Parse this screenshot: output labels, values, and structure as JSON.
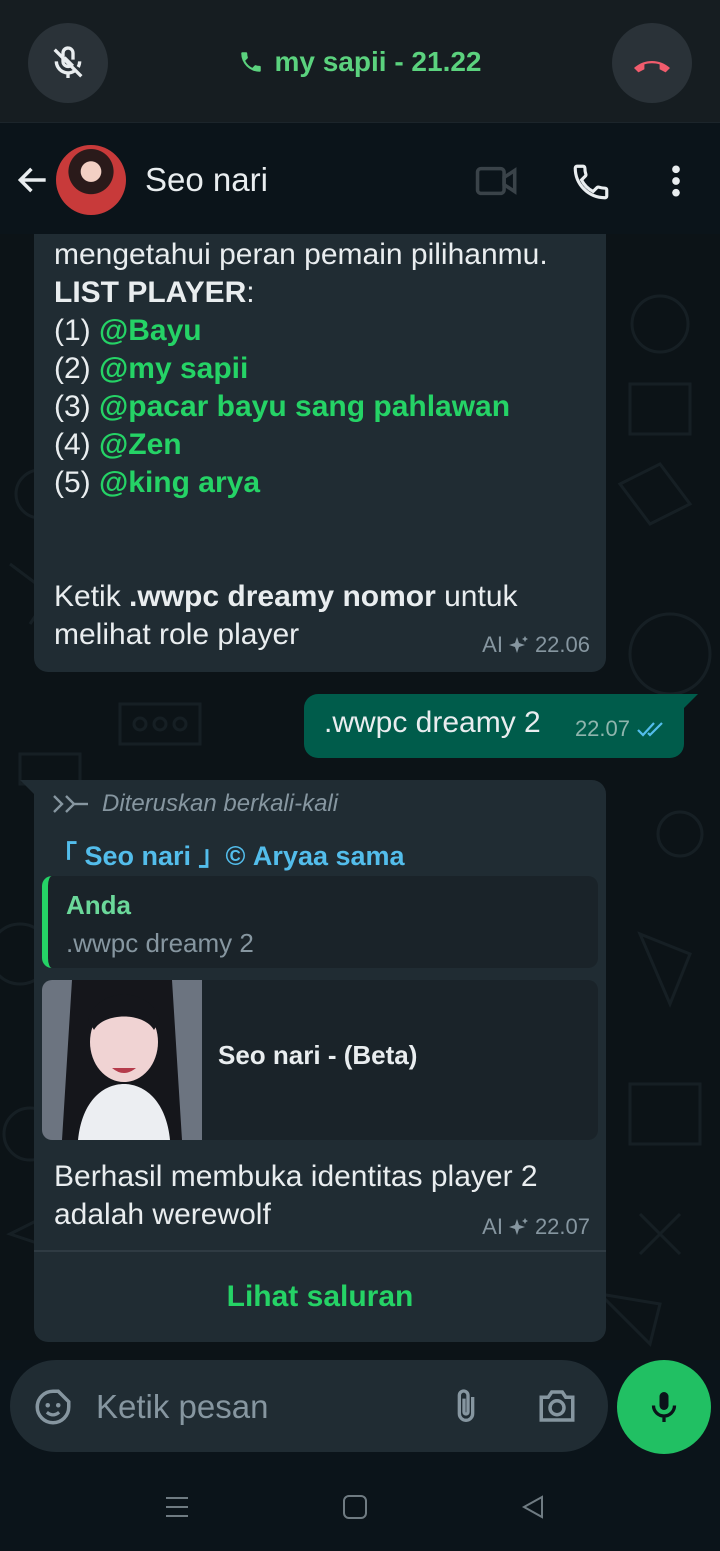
{
  "call": {
    "label": "my sapii - 21.22",
    "mute_icon": "mic-off-icon",
    "end_icon": "call-end-icon"
  },
  "header": {
    "contact_name": "Seo nari",
    "icons": [
      "back-arrow-icon",
      "video-call-icon",
      "phone-icon",
      "more-vert-icon"
    ]
  },
  "messages": {
    "m1": {
      "line_intro": "mengetahui peran pemain pilihanmu.",
      "list_title": "LIST PLAYER",
      "list_colon": ":",
      "players": [
        {
          "num": "(1)",
          "name": "@Bayu"
        },
        {
          "num": "(2)",
          "name": "@my sapii"
        },
        {
          "num": "(3)",
          "name": "@pacar bayu sang pahlawan"
        },
        {
          "num": "(4)",
          "name": "@Zen"
        },
        {
          "num": "(5)",
          "name": "@king arya"
        }
      ],
      "instr_pre": "Ketik ",
      "instr_cmd": ".wwpc dreamy nomor",
      "instr_post": " untuk",
      "instr_line2": "melihat role player",
      "ai_label": "AI",
      "time": "22.06"
    },
    "m2": {
      "text": ".wwpc dreamy 2",
      "time": "22.07"
    },
    "m3": {
      "forwarded": "Diteruskan berkali-kali",
      "sender": "「 Seo nari 」© Aryaa sama",
      "quote_who": "Anda",
      "quote_text": ".wwpc dreamy 2",
      "link_title": "Seo nari - (Beta)",
      "line1": "Berhasil membuka identitas player 2",
      "line2": "adalah werewolf",
      "ai_label": "AI",
      "time": "22.07",
      "channel_button": "Lihat saluran"
    }
  },
  "input": {
    "placeholder": "Ketik pesan"
  },
  "colors": {
    "accent": "#25d366",
    "bubble_in": "#202c33",
    "bubble_out": "#005c4b",
    "call_text": "#5bd27e",
    "sender": "#53bdeb"
  }
}
